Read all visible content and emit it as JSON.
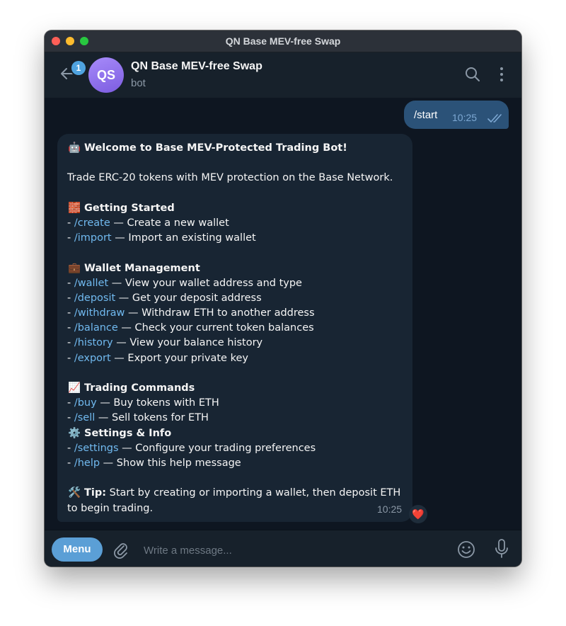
{
  "window": {
    "title": "QN Base MEV-free Swap"
  },
  "header": {
    "unread_count": "1",
    "avatar_initials": "QS",
    "name": "QN Base MEV-free Swap",
    "status": "bot"
  },
  "outgoing": {
    "text": "/start",
    "time": "10:25"
  },
  "incoming": {
    "time": "10:25",
    "reaction": "❤️",
    "title_emoji": "🤖",
    "title": "Welcome to Base MEV-Protected Trading Bot!",
    "intro": "Trade ERC-20 tokens with MEV protection on the Base Network.",
    "sections": [
      {
        "emoji": "🧱",
        "title": "Getting Started",
        "items": [
          {
            "cmd": "/create",
            "desc": " — Create a new wallet"
          },
          {
            "cmd": "/import",
            "desc": " — Import an existing wallet"
          }
        ]
      },
      {
        "emoji": "💼",
        "title": "Wallet Management",
        "items": [
          {
            "cmd": "/wallet",
            "desc": " — View your wallet address and type"
          },
          {
            "cmd": "/deposit",
            "desc": " — Get your deposit address"
          },
          {
            "cmd": "/withdraw",
            "desc": " — Withdraw ETH to another address"
          },
          {
            "cmd": "/balance",
            "desc": " — Check your current token balances"
          },
          {
            "cmd": "/history",
            "desc": " — View your balance history"
          },
          {
            "cmd": "/export",
            "desc": " — Export your private key"
          }
        ]
      },
      {
        "emoji": "📈",
        "title": "Trading Commands",
        "items": [
          {
            "cmd": "/buy",
            "desc": " — Buy tokens with ETH"
          },
          {
            "cmd": "/sell",
            "desc": " — Sell tokens for ETH"
          }
        ]
      },
      {
        "emoji": "⚙️",
        "title": "Settings & Info",
        "items": [
          {
            "cmd": "/settings",
            "desc": " — Configure your trading preferences"
          },
          {
            "cmd": "/help",
            "desc": " — Show this help message"
          }
        ]
      }
    ],
    "tip_emoji": "🛠️",
    "tip_label": "Tip:",
    "tip_line1": " Start by creating or importing a wallet, then deposit ETH",
    "tip_line2": "to begin trading."
  },
  "composer": {
    "menu_label": "Menu",
    "placeholder": "Write a message..."
  }
}
